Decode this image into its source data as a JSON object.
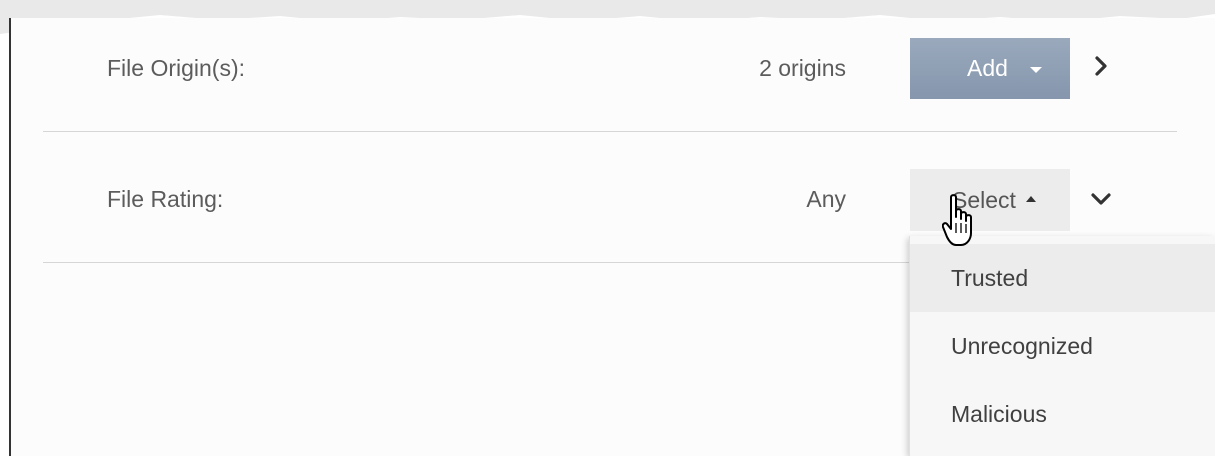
{
  "rows": {
    "origins": {
      "label": "File Origin(s):",
      "value": "2 origins",
      "button_label": "Add"
    },
    "rating": {
      "label": "File Rating:",
      "value": "Any",
      "button_label": "Select"
    }
  },
  "rating_dropdown": {
    "items": [
      {
        "label": "Trusted"
      },
      {
        "label": "Unrecognized"
      },
      {
        "label": "Malicious"
      }
    ]
  },
  "icons": {
    "add_caret": "caret-down-icon",
    "origins_expand": "chevron-right-icon",
    "select_caret": "caret-up-icon",
    "rating_expand": "chevron-down-icon",
    "cursor": "hand-pointer-icon"
  },
  "colors": {
    "add_button": "#8d9db3",
    "select_button": "#ececec",
    "divider": "#d6d6d6",
    "text": "#5c5c5c"
  }
}
